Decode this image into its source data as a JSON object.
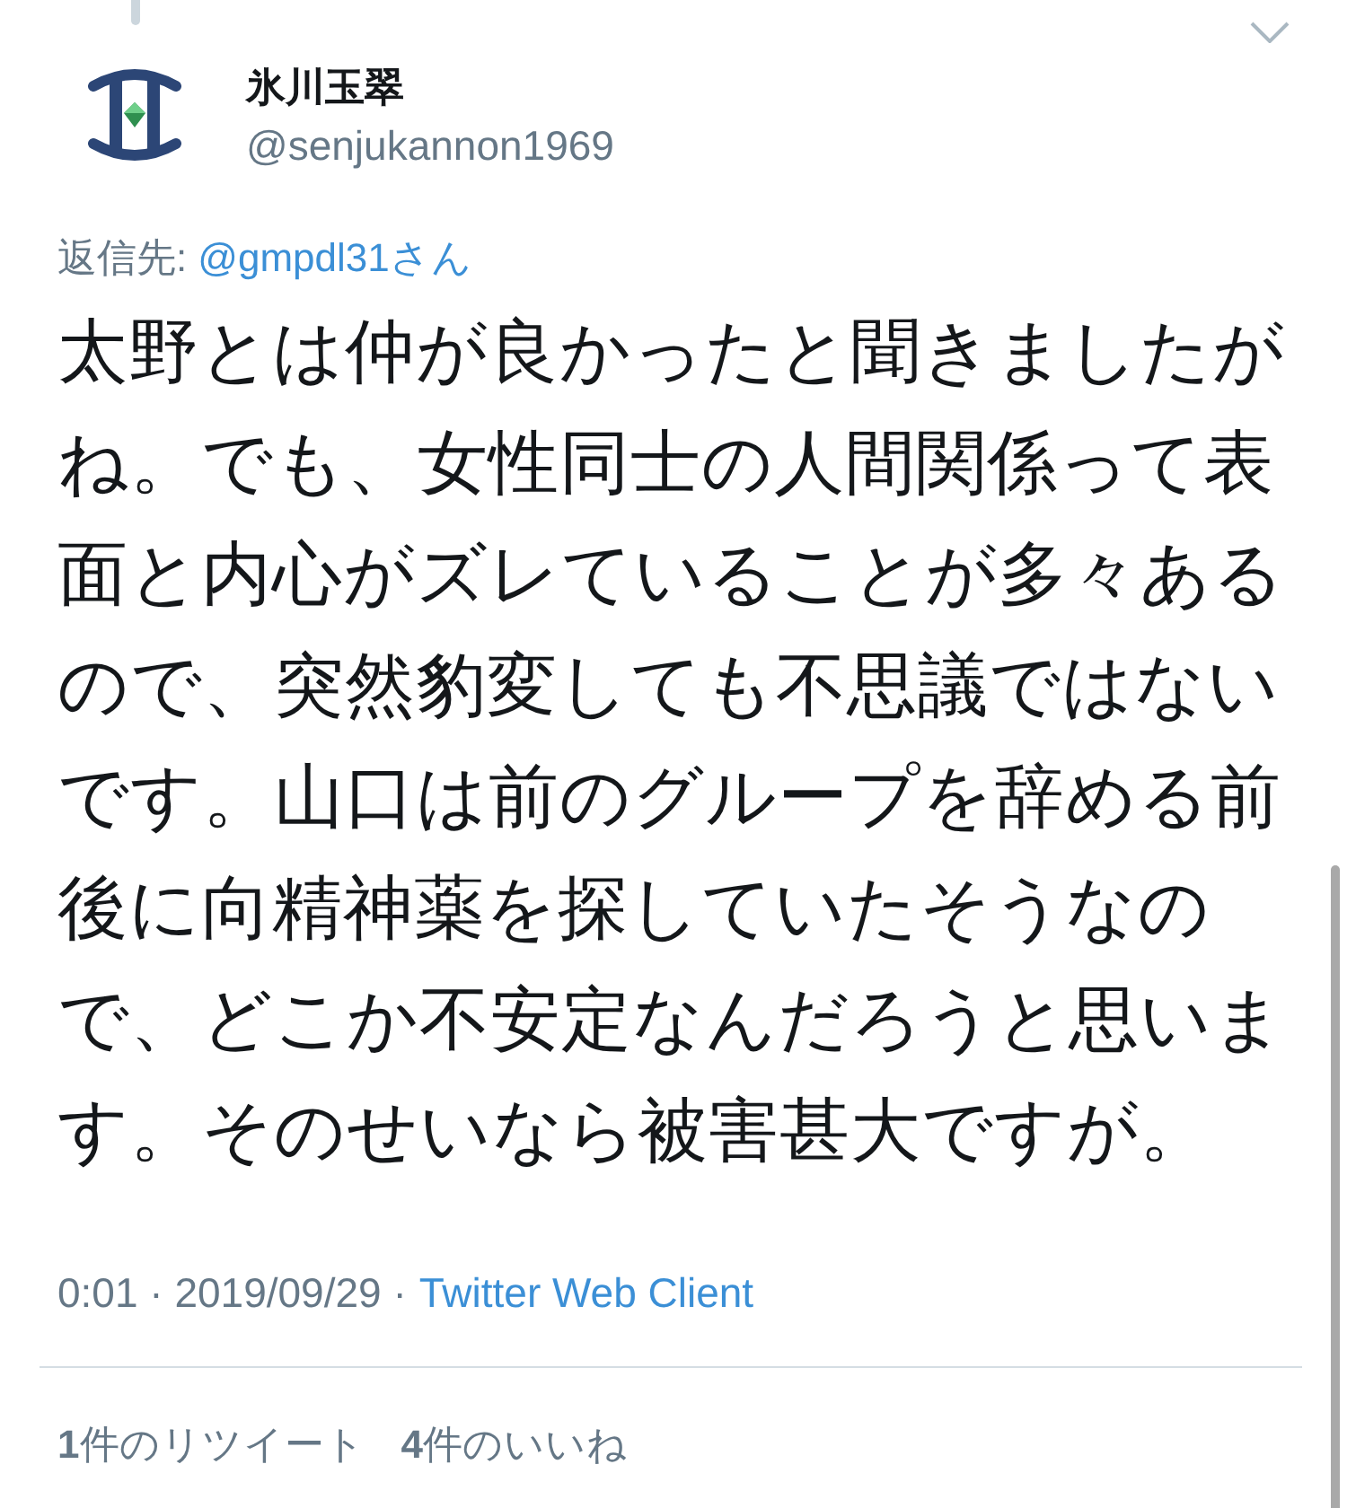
{
  "author": {
    "name": "氷川玉翠",
    "handle": "@senjukannon1969"
  },
  "reply_to": {
    "label": "返信先:",
    "user": "@gmpdl31さん"
  },
  "text": "太野とは仲が良かったと聞きましたがね。でも、女性同士の人間関係って表面と内心がズレていることが多々あるので、突然豹変しても不思議ではないです。山口は前のグループを辞める前後に向精神薬を探していたそうなので、どこか不安定なんだろうと思います。そのせいなら被害甚大ですが。",
  "meta": {
    "timestamp": "0:01 · 2019/09/29 ·",
    "source": "Twitter Web Client"
  },
  "stats": [
    "**1**件のリツイート",
    "**4**件のいいね"
  ]
}
